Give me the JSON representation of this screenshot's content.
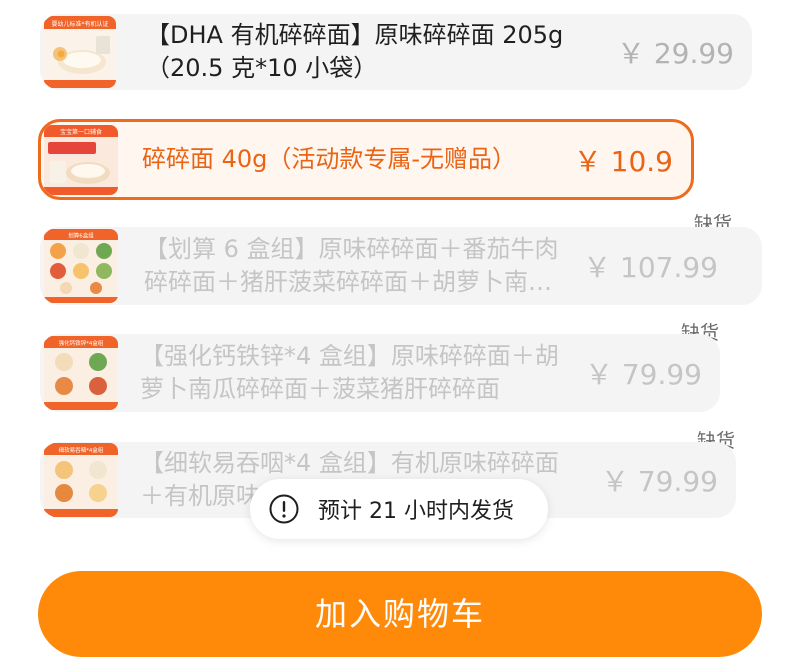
{
  "sku_list": {
    "items": [
      {
        "title": "【DHA 有机碎碎面】原味碎碎面 205g（20.5 克*10 小袋）",
        "price": "￥ 29.99",
        "thumb_caption": "婴幼儿标准*有机认证",
        "stock_status": ""
      },
      {
        "title": "碎碎面 40g（活动款专属-无赠品）",
        "price": "￥ 10.9",
        "thumb_caption": "宝宝第一口辅食",
        "stock_status": ""
      },
      {
        "title": "【划算 6 盒组】原味碎碎面＋番茄牛肉碎碎面＋猪肝菠菜碎碎面＋胡萝卜南瓜碎碎面",
        "price": "￥ 107.99",
        "thumb_caption": "划算6盒组",
        "stock_status": "缺货"
      },
      {
        "title": "【强化钙铁锌*4 盒组】原味碎碎面＋胡萝卜南瓜碎碎面＋菠菜猪肝碎碎面",
        "price": "￥ 79.99",
        "thumb_caption": "强化钙铁锌*4盒组",
        "stock_status": "缺货"
      },
      {
        "title": "【细软易吞咽*4 盒组】有机原味碎碎面＋有机原味碎碎面",
        "price": "￥ 79.99",
        "thumb_caption": "细软易吞咽*4盒组",
        "stock_status": "缺货"
      }
    ]
  },
  "toast": {
    "icon": "exclamation-circle-icon",
    "text": "预计 21 小时内发货"
  },
  "cart_button": {
    "label": "加入购物车"
  },
  "colors": {
    "accent": "#ff8a0a",
    "selected_text": "#e96415",
    "selected_border": "#ee6a1c",
    "card_background": "#f4f4f4"
  }
}
